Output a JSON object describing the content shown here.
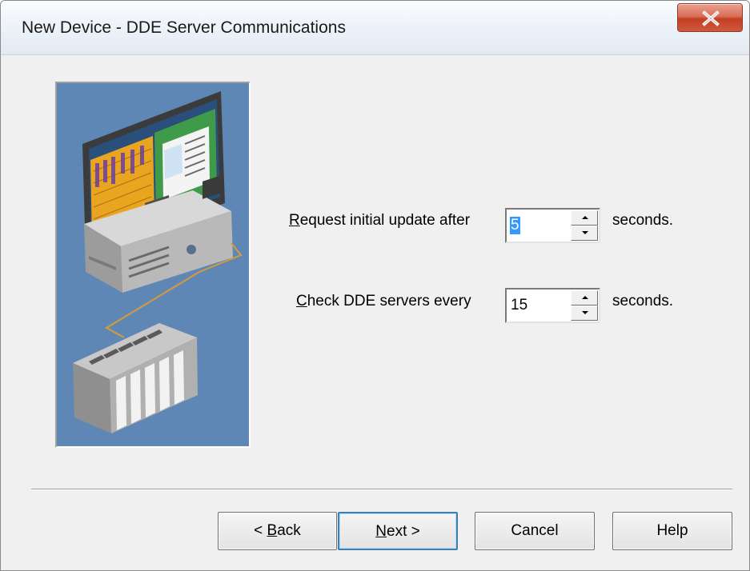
{
  "window": {
    "title": "New Device - DDE Server Communications",
    "close_glyph": "close-icon"
  },
  "settings": {
    "initial_update": {
      "label_mnemonic": "R",
      "label_rest": "equest initial update after",
      "value": "5",
      "unit": "seconds."
    },
    "check_servers": {
      "label_mnemonic": "C",
      "label_rest": "heck DDE servers every",
      "value": "15",
      "unit": "seconds."
    }
  },
  "buttons": {
    "back": {
      "prefix": "< ",
      "mnemonic": "B",
      "rest": "ack"
    },
    "next": {
      "mnemonic": "N",
      "rest": "ext >"
    },
    "cancel": {
      "label": "Cancel"
    },
    "help": {
      "label": "Help"
    }
  },
  "colors": {
    "illustration_bg": "#5f87b6",
    "close_button": "#c9482c",
    "selection": "#3399ff",
    "default_button_border": "#3c7fb1"
  },
  "icons": {
    "illustration": "computer-with-plc-illustration",
    "spin_up": "spin-up-arrow-icon",
    "spin_down": "spin-down-arrow-icon"
  }
}
